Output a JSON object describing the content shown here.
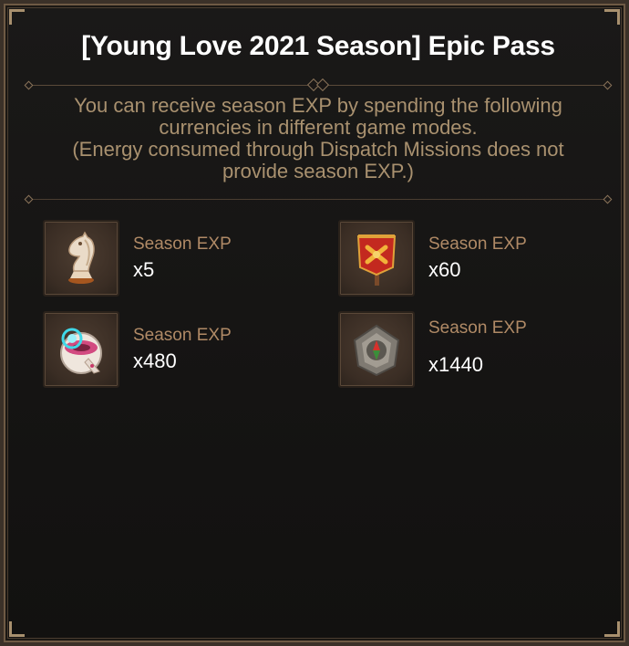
{
  "dialog": {
    "title": "[Young Love 2021 Season] Epic Pass",
    "description_lines": [
      "You can receive season EXP by spending the following",
      "currencies in different game modes.",
      "(Energy consumed through Dispatch Missions does not",
      "provide season EXP.)"
    ]
  },
  "items": [
    {
      "icon": "chess-knight-icon",
      "label": "Season EXP",
      "value": "x5"
    },
    {
      "icon": "war-banner-icon",
      "label": "Season EXP",
      "value": "x60"
    },
    {
      "icon": "hologram-device-icon",
      "label": "Season EXP",
      "value": "x480"
    },
    {
      "icon": "stone-compass-icon",
      "label": "Season EXP",
      "value": "x1440"
    }
  ],
  "colors": {
    "title": "#ffffff",
    "description": "#a9916f",
    "label": "#b08a66",
    "value": "#ffffff",
    "frame": "#6e5a44"
  }
}
